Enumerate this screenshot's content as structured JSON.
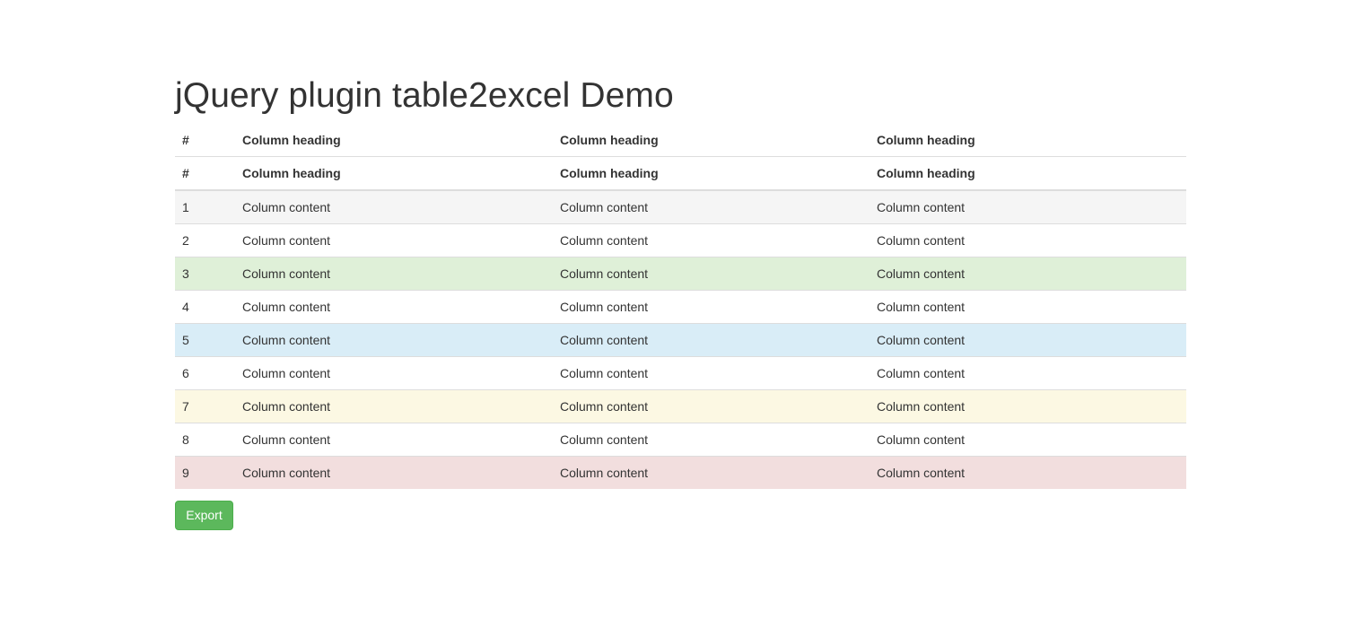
{
  "page": {
    "title": "jQuery plugin table2excel Demo"
  },
  "table": {
    "header_rows": [
      [
        "#",
        "Column heading",
        "Column heading",
        "Column heading"
      ],
      [
        "#",
        "Column heading",
        "Column heading",
        "Column heading"
      ]
    ],
    "rows": [
      {
        "cells": [
          "1",
          "Column content",
          "Column content",
          "Column content"
        ],
        "bg": "#f5f5f5",
        "variant": "active"
      },
      {
        "cells": [
          "2",
          "Column content",
          "Column content",
          "Column content"
        ],
        "bg": "#ffffff",
        "variant": "default"
      },
      {
        "cells": [
          "3",
          "Column content",
          "Column content",
          "Column content"
        ],
        "bg": "#dff0d8",
        "variant": "success"
      },
      {
        "cells": [
          "4",
          "Column content",
          "Column content",
          "Column content"
        ],
        "bg": "#ffffff",
        "variant": "default"
      },
      {
        "cells": [
          "5",
          "Column content",
          "Column content",
          "Column content"
        ],
        "bg": "#d9edf7",
        "variant": "info"
      },
      {
        "cells": [
          "6",
          "Column content",
          "Column content",
          "Column content"
        ],
        "bg": "#ffffff",
        "variant": "default"
      },
      {
        "cells": [
          "7",
          "Column content",
          "Column content",
          "Column content"
        ],
        "bg": "#fcf8e3",
        "variant": "warning"
      },
      {
        "cells": [
          "8",
          "Column content",
          "Column content",
          "Column content"
        ],
        "bg": "#ffffff",
        "variant": "default"
      },
      {
        "cells": [
          "9",
          "Column content",
          "Column content",
          "Column content"
        ],
        "bg": "#f2dede",
        "variant": "danger"
      }
    ]
  },
  "export_button": {
    "label": "Export",
    "color": "#5cb85c"
  }
}
